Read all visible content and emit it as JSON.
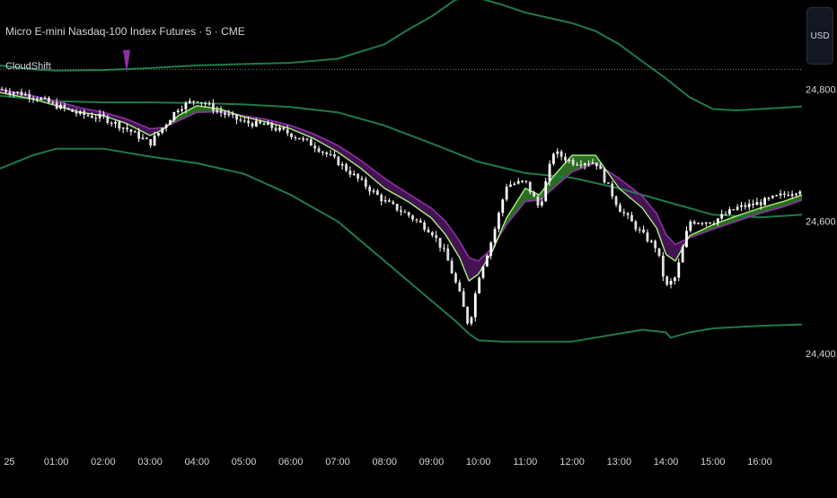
{
  "header": {
    "symbol_title": "Micro E-mini Nasdaq-100 Index Futures · 5 · CME",
    "indicator_name": "CloudShift",
    "currency": "USD"
  },
  "colors": {
    "band": "#1f7a4a",
    "fast_line": "#a6f27a",
    "slow_line": "#8e2fa8",
    "bull_cloud": "#3b8f2e",
    "bear_cloud": "#5a1a6e",
    "candle": "#ffffff",
    "axis_text": "#d1d4dc",
    "dotted_line": "#9598a1",
    "marker": "#8e2fa8"
  },
  "chart_data": {
    "type": "line",
    "title": "Micro E-mini Nasdaq-100 Index Futures · 5 · CME",
    "xlabel": "",
    "ylabel": "",
    "ylim": [
      24290,
      24935
    ],
    "price_ticks": [
      {
        "value": 24800,
        "label": "24,800.00"
      },
      {
        "value": 24600,
        "label": "24,600.00"
      },
      {
        "value": 24400,
        "label": "24,400.00"
      }
    ],
    "time_ticks": [
      {
        "t": 0,
        "label": "25"
      },
      {
        "t": 1,
        "label": "01:00"
      },
      {
        "t": 2,
        "label": "02:00"
      },
      {
        "t": 3,
        "label": "03:00"
      },
      {
        "t": 4,
        "label": "04:00"
      },
      {
        "t": 5,
        "label": "05:00"
      },
      {
        "t": 6,
        "label": "06:00"
      },
      {
        "t": 7,
        "label": "07:00"
      },
      {
        "t": 8,
        "label": "08:00"
      },
      {
        "t": 9,
        "label": "09:00"
      },
      {
        "t": 10,
        "label": "10:00"
      },
      {
        "t": 11,
        "label": "11:00"
      },
      {
        "t": 12,
        "label": "12:00"
      },
      {
        "t": 13,
        "label": "13:00"
      },
      {
        "t": 14,
        "label": "14:00"
      },
      {
        "t": 15,
        "label": "15:00"
      },
      {
        "t": 16,
        "label": "16:00"
      }
    ],
    "xrange": [
      -0.2,
      16.9
    ],
    "dotted_level": 24830,
    "signal_marker": {
      "t": 2.5,
      "price": 24843
    },
    "series": [
      {
        "role": "upper_band",
        "x": [
          -0.2,
          0.5,
          1,
          2,
          3,
          4,
          5,
          6,
          7,
          8,
          8.5,
          9,
          9.5,
          9.8,
          10,
          10.5,
          11,
          12,
          12.5,
          13,
          13.5,
          14,
          14.5,
          15,
          15.5,
          16,
          16.5,
          16.9
        ],
        "y": [
          24836,
          24830,
          24828,
          24829,
          24832,
          24836,
          24838,
          24840,
          24846,
          24868,
          24890,
          24910,
          24935,
          24940,
          24938,
          24928,
          24916,
          24900,
          24888,
          24868,
          24842,
          24816,
          24788,
          24770,
          24768,
          24770,
          24772,
          24774
        ]
      },
      {
        "role": "middle_band",
        "x": [
          -0.2,
          1,
          2,
          3,
          4,
          5,
          6,
          7,
          8,
          9,
          10,
          11,
          12,
          13,
          14,
          15,
          16,
          16.9
        ],
        "y": [
          24790,
          24782,
          24780,
          24780,
          24779,
          24777,
          24773,
          24765,
          24745,
          24718,
          24690,
          24673,
          24666,
          24650,
          24630,
          24610,
          24606,
          24610
        ]
      },
      {
        "role": "lower_band",
        "x": [
          -0.2,
          0.5,
          1,
          2,
          3,
          4,
          5,
          6,
          7,
          7.5,
          8,
          8.5,
          9,
          9.5,
          9.8,
          10,
          10.5,
          11,
          12,
          13,
          13.5,
          14,
          14.1,
          14.5,
          15,
          16,
          16.9
        ],
        "y": [
          24680,
          24700,
          24710,
          24710,
          24698,
          24688,
          24672,
          24640,
          24600,
          24570,
          24540,
          24510,
          24480,
          24450,
          24430,
          24420,
          24418,
          24418,
          24418,
          24430,
          24436,
          24432,
          24424,
          24432,
          24438,
          24442,
          24444
        ]
      },
      {
        "role": "fast_ma",
        "x": [
          -0.2,
          0.5,
          1,
          1.5,
          2,
          2.5,
          3,
          3.3,
          3.6,
          4,
          4.5,
          5,
          5.5,
          6,
          6.5,
          7,
          7.5,
          8,
          8.5,
          9,
          9.3,
          9.6,
          9.8,
          10,
          10.3,
          10.6,
          11,
          11.3,
          11.6,
          12,
          12.5,
          13,
          13.5,
          13.8,
          14,
          14.2,
          14.5,
          15,
          15.5,
          16,
          16.5,
          16.9
        ],
        "y": [
          24795,
          24785,
          24775,
          24765,
          24760,
          24748,
          24730,
          24740,
          24760,
          24775,
          24770,
          24758,
          24750,
          24740,
          24725,
          24705,
          24680,
          24650,
          24630,
          24605,
          24580,
          24545,
          24510,
          24520,
          24555,
          24605,
          24650,
          24640,
          24668,
          24700,
          24700,
          24650,
          24620,
          24590,
          24550,
          24540,
          24578,
          24595,
          24608,
          24620,
          24630,
          24640
        ]
      },
      {
        "role": "slow_ma",
        "x": [
          -0.2,
          0.5,
          1,
          1.5,
          2,
          2.5,
          3,
          3.3,
          3.6,
          4,
          4.5,
          5,
          5.5,
          6,
          6.5,
          7,
          7.5,
          8,
          8.5,
          9,
          9.3,
          9.6,
          9.8,
          10,
          10.3,
          10.6,
          11,
          11.3,
          11.6,
          12,
          12.5,
          13,
          13.5,
          13.8,
          14,
          14.2,
          14.5,
          15,
          15.5,
          16,
          16.5,
          16.9
        ],
        "y": [
          24800,
          24790,
          24782,
          24772,
          24765,
          24755,
          24740,
          24742,
          24752,
          24765,
          24766,
          24760,
          24754,
          24745,
          24732,
          24715,
          24692,
          24665,
          24642,
          24620,
          24600,
          24570,
          24545,
          24540,
          24560,
          24595,
          24630,
          24632,
          24650,
          24675,
          24688,
          24665,
          24638,
          24612,
          24580,
          24565,
          24575,
          24588,
          24600,
          24612,
          24622,
          24632
        ]
      },
      {
        "role": "price",
        "x": [
          -0.2,
          0.5,
          1,
          1.5,
          2,
          2.5,
          3,
          3.3,
          3.6,
          4,
          4.5,
          5,
          5.5,
          6,
          6.5,
          7,
          7.5,
          8,
          8.5,
          9,
          9.3,
          9.6,
          9.8,
          10,
          10.3,
          10.6,
          11,
          11.3,
          11.6,
          12,
          12.5,
          13,
          13.5,
          13.8,
          14,
          14.2,
          14.5,
          15,
          15.5,
          16,
          16.5,
          16.9
        ],
        "y": [
          24800,
          24790,
          24775,
          24762,
          24757,
          24740,
          24718,
          24745,
          24772,
          24785,
          24765,
          24750,
          24745,
          24732,
          24715,
          24690,
          24660,
          24630,
          24610,
          24585,
          24550,
          24490,
          24440,
          24515,
          24575,
          24655,
          24660,
          24620,
          24705,
          24690,
          24690,
          24620,
          24580,
          24560,
          24500,
          24515,
          24600,
          24600,
          24620,
          24628,
          24640,
          24650
        ]
      }
    ]
  }
}
